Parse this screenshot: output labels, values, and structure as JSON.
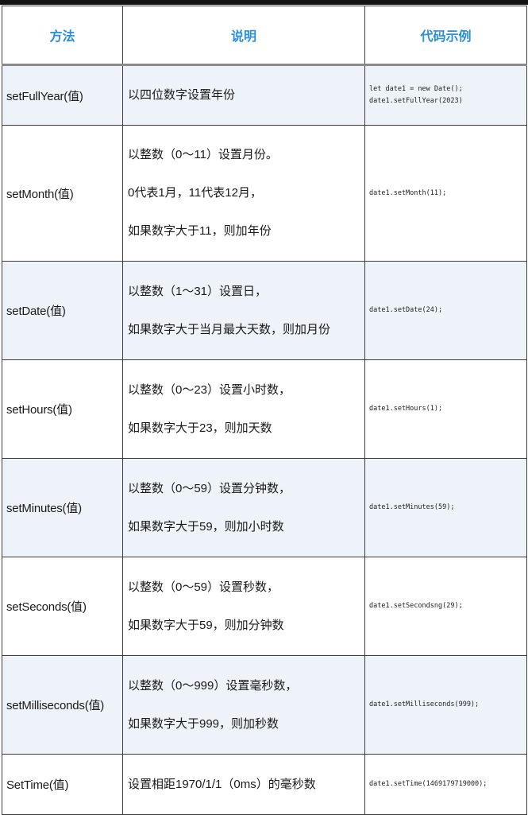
{
  "header": {
    "col_method": "方法",
    "col_desc": "说明",
    "col_code": "代码示例"
  },
  "rows": [
    {
      "method": "setFullYear(值)",
      "desc": [
        "以四位数字设置年份"
      ],
      "code": [
        "let date1 = new Date();",
        "date1.setFullYear(2023)"
      ]
    },
    {
      "method": "setMonth(值)",
      "desc": [
        "以整数（0～11）设置月份。",
        "0代表1月，11代表12月，",
        "如果数字大于11，则加年份"
      ],
      "code": [
        "date1.setMonth(11);"
      ]
    },
    {
      "method": "setDate(值)",
      "desc": [
        "以整数（1～31）设置日，",
        "如果数字大于当月最大天数，则加月份"
      ],
      "code": [
        "date1.setDate(24);"
      ]
    },
    {
      "method": "setHours(值)",
      "desc": [
        "以整数（0～23）设置小时数，",
        "如果数字大于23，则加天数"
      ],
      "code": [
        "date1.setHours(1);"
      ]
    },
    {
      "method": "setMinutes(值)",
      "desc": [
        "以整数（0～59）设置分钟数，",
        "如果数字大于59，则加小时数"
      ],
      "code": [
        "date1.setMinutes(59);"
      ]
    },
    {
      "method": "setSeconds(值)",
      "desc": [
        "以整数（0～59）设置秒数，",
        "如果数字大于59，则加分钟数"
      ],
      "code": [
        "date1.setSecondsng(29);"
      ]
    },
    {
      "method": "setMilliseconds(值)",
      "desc": [
        "以整数（0～999）设置毫秒数，",
        "如果数字大于999，则加秒数"
      ],
      "code": [
        "date1.setMilliseconds(999);"
      ]
    },
    {
      "method": "SetTime(值)",
      "desc": [
        "设置相距1970/1/1（0ms）的毫秒数"
      ],
      "code": [
        "date1.setTime(1469179719000);"
      ]
    }
  ]
}
